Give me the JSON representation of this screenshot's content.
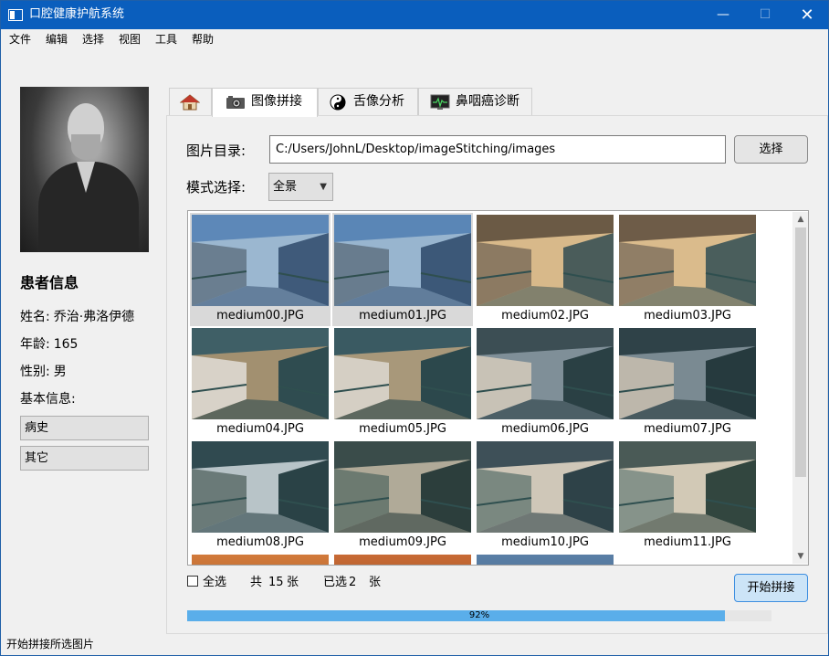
{
  "window": {
    "title": "口腔健康护航系统",
    "controls": {
      "minimize": "—",
      "maximize": "☐",
      "close": "✕"
    }
  },
  "menu": [
    "文件",
    "编辑",
    "选择",
    "视图",
    "工具",
    "帮助"
  ],
  "patient": {
    "section_title": "患者信息",
    "name_label": "姓名:",
    "name_value": "乔治·弗洛伊德",
    "age_label": "年龄:",
    "age_value": "165",
    "gender_label": "性别:",
    "gender_value": "男",
    "basic_label": "基本信息:",
    "buttons": [
      "病史",
      "其它"
    ]
  },
  "tabs": [
    {
      "label": "",
      "icon": "home-icon",
      "active": false
    },
    {
      "label": "图像拼接",
      "icon": "camera-icon",
      "active": true
    },
    {
      "label": "舌像分析",
      "icon": "yin-yang-icon",
      "active": false
    },
    {
      "label": "鼻咽癌诊断",
      "icon": "monitor-icon",
      "active": false
    }
  ],
  "stitching": {
    "dir_label": "图片目录:",
    "dir_value": "C:/Users/JohnL/Desktop/imageStitching/images",
    "select_button": "选择",
    "mode_label": "模式选择:",
    "mode_value": "全景",
    "images": [
      {
        "name": "medium00.JPG",
        "selected": true
      },
      {
        "name": "medium01.JPG",
        "selected": true
      },
      {
        "name": "medium02.JPG",
        "selected": false
      },
      {
        "name": "medium03.JPG",
        "selected": false
      },
      {
        "name": "medium04.JPG",
        "selected": false
      },
      {
        "name": "medium05.JPG",
        "selected": false
      },
      {
        "name": "medium06.JPG",
        "selected": false
      },
      {
        "name": "medium07.JPG",
        "selected": false
      },
      {
        "name": "medium08.JPG",
        "selected": false
      },
      {
        "name": "medium09.JPG",
        "selected": false
      },
      {
        "name": "medium10.JPG",
        "selected": false
      },
      {
        "name": "medium11.JPG",
        "selected": false
      }
    ],
    "select_all_label": "全选",
    "total_prefix": "共",
    "total_count": "15",
    "total_unit": "张",
    "selected_prefix": "已选",
    "selected_count": "2",
    "selected_unit": "张",
    "start_button": "开始拼接",
    "progress_percent": 92,
    "progress_text": "92%"
  },
  "status": "开始拼接所选图片",
  "colors": {
    "titlebar": "#0a5ebd",
    "progress": "#5aaeea",
    "selected_thumb": "#d9d9d9",
    "start_button": "#cce4f7"
  }
}
